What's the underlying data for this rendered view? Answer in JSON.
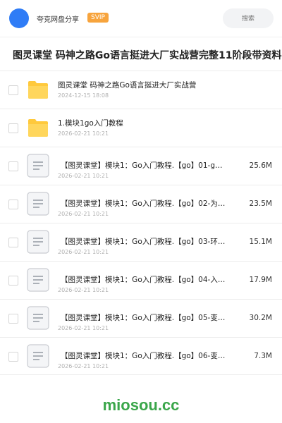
{
  "header": {
    "app_name": "夸克网盘分享",
    "badge": "SVIP",
    "search_placeholder": "搜索",
    "avatar_color": "#2f7cf6"
  },
  "share_title": "图灵课堂 码神之路Go语言挺进大厂实战营完整11阶段带资料",
  "items": [
    {
      "type": "folder",
      "name": "图灵课堂 码神之路Go语言挺进大厂实战营",
      "date": "2024-12-15 18:08",
      "size": ""
    },
    {
      "type": "folder",
      "name": "1.模块1go入门教程",
      "date": "2026-02-21 10:21",
      "size": ""
    },
    {
      "type": "file",
      "name": "【图灵课堂】模块1：Go入门教程.【go】01-g…",
      "date": "2026-02-21 10:21",
      "size": "25.6M"
    },
    {
      "type": "file",
      "name": "【图灵课堂】模块1：Go入门教程.【go】02-为…",
      "date": "2026-02-21 10:21",
      "size": "23.5M"
    },
    {
      "type": "file",
      "name": "【图灵课堂】模块1：Go入门教程.【go】03-环…",
      "date": "2026-02-21 10:21",
      "size": "15.1M"
    },
    {
      "type": "file",
      "name": "【图灵课堂】模块1：Go入门教程.【go】04-入…",
      "date": "2026-02-21 10:21",
      "size": "17.9M"
    },
    {
      "type": "file",
      "name": "【图灵课堂】模块1：Go入门教程.【go】05-变…",
      "date": "2026-02-21 10:21",
      "size": "30.2M"
    },
    {
      "type": "file",
      "name": "【图灵课堂】模块1：Go入门教程.【go】06-变…",
      "date": "2026-02-21 10:21",
      "size": "7.3M"
    }
  ],
  "watermark": "miosou.cc",
  "colors": {
    "folder": "#ffc93c",
    "badge": "#f7a43d",
    "watermark": "#3aa64a"
  }
}
